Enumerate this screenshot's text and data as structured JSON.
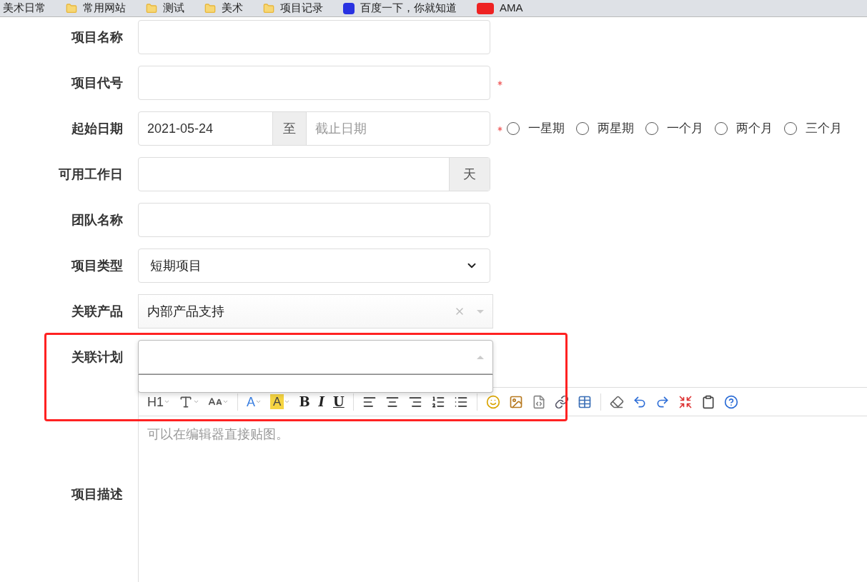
{
  "bookmarks": [
    {
      "label": "美术日常",
      "kind": "plain"
    },
    {
      "label": "常用网站",
      "kind": "folder"
    },
    {
      "label": "测试",
      "kind": "folder"
    },
    {
      "label": "美术",
      "kind": "folder"
    },
    {
      "label": "项目记录",
      "kind": "folder"
    },
    {
      "label": "百度一下，你就知道",
      "kind": "baidu"
    },
    {
      "label": "AMA",
      "kind": "red"
    }
  ],
  "fields": [
    {
      "label": "项目名称",
      "kind": "text",
      "required": false
    },
    {
      "label": "项目代号",
      "kind": "text",
      "required": true
    },
    {
      "label": "起始日期",
      "kind": "daterange",
      "value": "2021-05-24",
      "separator": "至",
      "placeholder": "截止日期",
      "required": true,
      "options": [
        {
          "label": "一星期",
          "selected": false
        },
        {
          "label": "两星期",
          "selected": false
        },
        {
          "label": "一个月",
          "selected": false
        },
        {
          "label": "两个月",
          "selected": false
        },
        {
          "label": "三个月",
          "selected": false
        }
      ]
    },
    {
      "label": "可用工作日",
      "kind": "addon",
      "addon": "天",
      "required": false
    },
    {
      "label": "团队名称",
      "kind": "text",
      "required": false
    },
    {
      "label": "项目类型",
      "kind": "select",
      "value": "短期项目",
      "required": false
    },
    {
      "label": "关联产品",
      "kind": "chosen",
      "value": "内部产品支持",
      "required": false,
      "expanded": false
    },
    {
      "label": "关联计划",
      "kind": "chosen",
      "required": false,
      "expanded": true
    }
  ],
  "editor": {
    "label": "项目描述",
    "placeholder": "可以在编辑器直接贴图。",
    "toolbar": [
      {
        "kind": "text",
        "text": "H1",
        "caret": true
      },
      {
        "kind": "icon",
        "caret": true
      },
      {
        "kind": "icon",
        "caret": true
      },
      {
        "kind": "separator"
      },
      {
        "kind": "text",
        "text": "A",
        "caret": true
      },
      {
        "kind": "highlight",
        "text": "A",
        "caret": true
      },
      {
        "kind": "text",
        "text": "B",
        "caret": false
      },
      {
        "kind": "text",
        "text": "I",
        "caret": false
      },
      {
        "kind": "text",
        "text": "U",
        "caret": false
      },
      {
        "kind": "separator"
      },
      {
        "kind": "icon",
        "caret": false
      },
      {
        "kind": "icon",
        "caret": false
      },
      {
        "kind": "icon",
        "caret": false
      },
      {
        "kind": "icon",
        "caret": false
      },
      {
        "kind": "icon",
        "caret": false
      },
      {
        "kind": "separator"
      },
      {
        "kind": "icon",
        "caret": false
      },
      {
        "kind": "icon",
        "caret": false
      },
      {
        "kind": "icon",
        "caret": false
      },
      {
        "kind": "icon",
        "caret": false
      },
      {
        "kind": "icon",
        "caret": false
      },
      {
        "kind": "separator"
      },
      {
        "kind": "icon",
        "caret": false
      },
      {
        "kind": "icon",
        "caret": false
      },
      {
        "kind": "icon",
        "caret": false
      },
      {
        "kind": "icon",
        "caret": false
      },
      {
        "kind": "icon",
        "caret": false
      },
      {
        "kind": "icon",
        "caret": false
      }
    ]
  }
}
